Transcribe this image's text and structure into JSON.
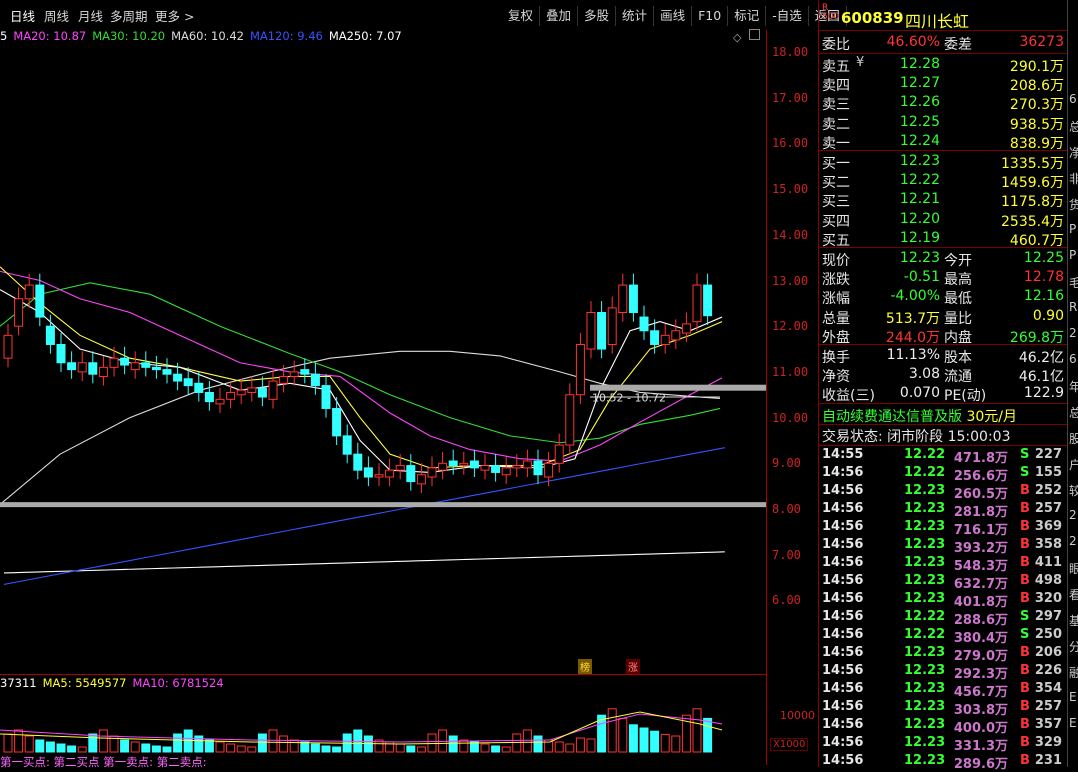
{
  "period_tabs": [
    "日线",
    "周线",
    "月线",
    "多周期",
    "更多"
  ],
  "toolbar": [
    "复权",
    "叠加",
    "多股",
    "统计",
    "画线",
    "F10",
    "标记",
    "-自选",
    "返回"
  ],
  "ma_legend": [
    {
      "label": "5",
      "color": "#ffffff"
    },
    {
      "label": "MA20: 10.87",
      "color": "#ff44ff"
    },
    {
      "label": "MA30: 10.20",
      "color": "#33dd33"
    },
    {
      "label": "MA60: 10.42",
      "color": "#dddddd"
    },
    {
      "label": "MA120: 9.46",
      "color": "#3355ff"
    },
    {
      "label": "MA250: 7.07",
      "color": "#ffffff"
    }
  ],
  "y_ticks": [
    "18.00",
    "17.00",
    "16.00",
    "15.00",
    "14.00",
    "13.00",
    "12.00",
    "11.00",
    "10.00",
    "9.00",
    "8.00",
    "7.00",
    "6.00"
  ],
  "range_label": "10.52 - 10.72",
  "badges": {
    "bang": "榜",
    "zhang": "涨"
  },
  "volume_legend": [
    {
      "label": "37311",
      "color": "#ffffff"
    },
    {
      "label": "MA5: 5549577",
      "color": "#ffff33"
    },
    {
      "label": "MA10: 6781524",
      "color": "#ff44ff"
    }
  ],
  "volume_ticks": {
    "top": "10000",
    "unit": "X1000"
  },
  "signals": "第一买点: 第二买点  第一卖点: 第二卖点:",
  "stock": {
    "badge_r": "R",
    "badge_num": "500",
    "code": "600839",
    "name": "四川长虹"
  },
  "weibi": {
    "label": "委比",
    "value": "46.60%",
    "label2": "委差",
    "value2": "36273"
  },
  "asks": [
    {
      "label": "卖五",
      "price": "12.28",
      "vol": "290.1万"
    },
    {
      "label": "卖四",
      "price": "12.27",
      "vol": "208.6万"
    },
    {
      "label": "卖三",
      "price": "12.26",
      "vol": "270.3万"
    },
    {
      "label": "卖二",
      "price": "12.25",
      "vol": "938.5万"
    },
    {
      "label": "卖一",
      "price": "12.24",
      "vol": "838.9万"
    }
  ],
  "bids": [
    {
      "label": "买一",
      "price": "12.23",
      "vol": "1335.5万"
    },
    {
      "label": "买二",
      "price": "12.22",
      "vol": "1459.6万"
    },
    {
      "label": "买三",
      "price": "12.21",
      "vol": "1175.8万"
    },
    {
      "label": "买四",
      "price": "12.20",
      "vol": "2535.4万"
    },
    {
      "label": "买五",
      "price": "12.19",
      "vol": "460.7万"
    }
  ],
  "quote": [
    {
      "l1": "现价",
      "v1": "12.23",
      "c1": "#33ff33",
      "l2": "今开",
      "v2": "12.25",
      "c2": "#33ff33"
    },
    {
      "l1": "涨跌",
      "v1": "-0.51",
      "c1": "#33ff33",
      "l2": "最高",
      "v2": "12.78",
      "c2": "#ff3333"
    },
    {
      "l1": "涨幅",
      "v1": "-4.00%",
      "c1": "#33ff33",
      "l2": "最低",
      "v2": "12.16",
      "c2": "#33ff33"
    },
    {
      "l1": "总量",
      "v1": "513.7万",
      "c1": "#ffff33",
      "l2": "量比",
      "v2": "0.90",
      "c2": "#ffff33"
    },
    {
      "l1": "外盘",
      "v1": "244.0万",
      "c1": "#ff3333",
      "l2": "内盘",
      "v2": "269.8万",
      "c2": "#33ff33"
    }
  ],
  "fund": [
    {
      "l1": "换手",
      "v1": "11.13%",
      "l2": "股本",
      "v2": "46.2亿"
    },
    {
      "l1": "净资",
      "v1": "3.08",
      "l2": "流通",
      "v2": "46.1亿"
    },
    {
      "l1": "收益(三)",
      "v1": "0.070",
      "l2": "PE(动)",
      "v2": "122.9"
    }
  ],
  "promo": {
    "text": "自动续费通达信普及版",
    "price": "30元/月"
  },
  "trade_status": "交易状态: 闭市阶段 15:00:03",
  "ticks": [
    {
      "t": "14:55",
      "p": "12.22",
      "v": "471.8万",
      "bs": "S",
      "n": "227"
    },
    {
      "t": "14:56",
      "p": "12.22",
      "v": "256.6万",
      "bs": "S",
      "n": "155"
    },
    {
      "t": "14:56",
      "p": "12.23",
      "v": "260.5万",
      "bs": "B",
      "n": "252"
    },
    {
      "t": "14:56",
      "p": "12.23",
      "v": "281.8万",
      "bs": "B",
      "n": "257"
    },
    {
      "t": "14:56",
      "p": "12.23",
      "v": "716.1万",
      "bs": "B",
      "n": "369"
    },
    {
      "t": "14:56",
      "p": "12.23",
      "v": "393.2万",
      "bs": "B",
      "n": "358"
    },
    {
      "t": "14:56",
      "p": "12.23",
      "v": "548.3万",
      "bs": "B",
      "n": "411"
    },
    {
      "t": "14:56",
      "p": "12.23",
      "v": "632.7万",
      "bs": "B",
      "n": "498"
    },
    {
      "t": "14:56",
      "p": "12.23",
      "v": "401.8万",
      "bs": "B",
      "n": "320"
    },
    {
      "t": "14:56",
      "p": "12.22",
      "v": "288.6万",
      "bs": "S",
      "n": "297"
    },
    {
      "t": "14:56",
      "p": "12.22",
      "v": "380.4万",
      "bs": "S",
      "n": "250"
    },
    {
      "t": "14:56",
      "p": "12.23",
      "v": "279.0万",
      "bs": "B",
      "n": "206"
    },
    {
      "t": "14:56",
      "p": "12.23",
      "v": "292.3万",
      "bs": "B",
      "n": "226"
    },
    {
      "t": "14:56",
      "p": "12.23",
      "v": "456.7万",
      "bs": "B",
      "n": "354"
    },
    {
      "t": "14:56",
      "p": "12.23",
      "v": "303.8万",
      "bs": "B",
      "n": "257"
    },
    {
      "t": "14:56",
      "p": "12.23",
      "v": "400.0万",
      "bs": "B",
      "n": "357"
    },
    {
      "t": "14:56",
      "p": "12.23",
      "v": "331.3万",
      "bs": "B",
      "n": "329"
    },
    {
      "t": "14:56",
      "p": "12.23",
      "v": "289.6万",
      "bs": "B",
      "n": "231"
    }
  ],
  "edge_glyphs": [
    "6",
    "总",
    "净",
    "非",
    "货",
    "P",
    "P",
    "毛",
    "R",
    "2",
    "6",
    "年",
    "总",
    "股",
    "户",
    "较",
    "2",
    "2",
    "眼",
    "看",
    "基",
    "分",
    "融",
    "E",
    "E"
  ],
  "colors": {
    "up": "#ff3333",
    "down": "#33ffff",
    "green": "#33ff33",
    "axis": "#cc2222"
  }
}
